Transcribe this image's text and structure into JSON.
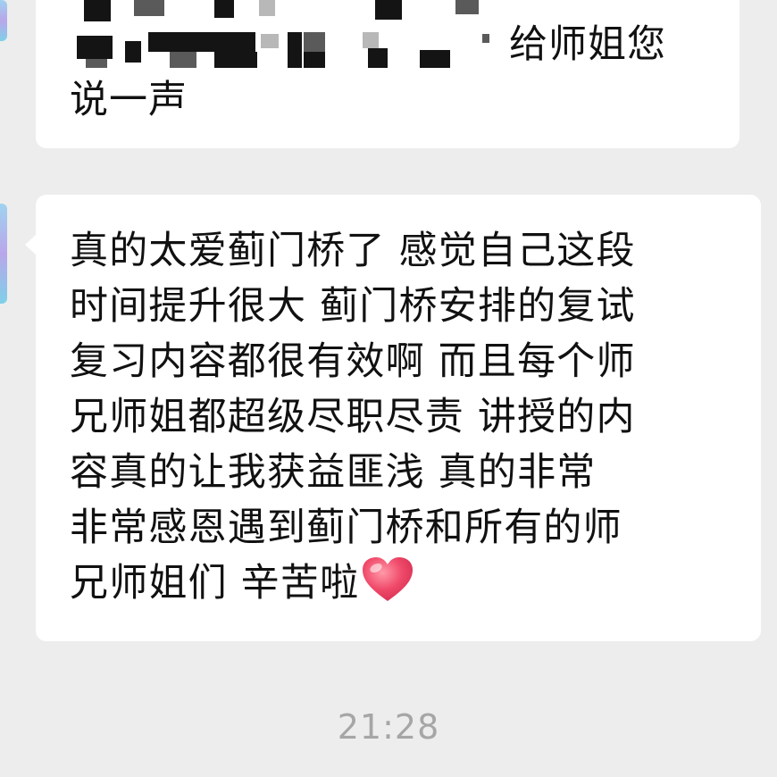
{
  "messages": [
    {
      "sender": "other",
      "text_visible_right": "给师姐您",
      "text_line2": "说一声"
    },
    {
      "sender": "other",
      "lines": [
        "真的太爱蓟门桥了 感觉自己这段",
        "时间提升很大 蓟门桥安排的复试",
        "复习内容都很有效啊 而且每个师",
        "兄师姐都超级尽职尽责 讲授的内",
        "容真的让我获益匪浅  真的非常",
        "非常感恩遇到蓟门桥和所有的师",
        "兄师姐们 辛苦啦"
      ],
      "emoji": "heart-icon"
    }
  ],
  "timestamp": "21:28",
  "colors": {
    "background": "#ededed",
    "bubble": "#ffffff",
    "text": "#111111",
    "timestamp": "#a6a6a6",
    "heart": "#f04a6a"
  }
}
